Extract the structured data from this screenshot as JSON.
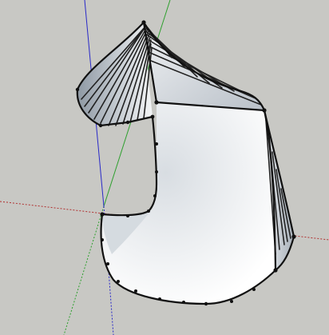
{
  "viewport": {
    "background_color": "#c8c8c4",
    "axes": {
      "red_axis_icon": "red-axis-line",
      "green_axis_icon": "green-axis-line",
      "blue_axis_icon": "blue-axis-line",
      "red_color": "#b03030",
      "green_color": "#2ea02e",
      "blue_color": "#2828c8"
    },
    "model": {
      "name": "swept-surface-model",
      "face_color": "#ffffff",
      "shade_color": "#9aa3ad",
      "edge_color": "#111111"
    }
  }
}
